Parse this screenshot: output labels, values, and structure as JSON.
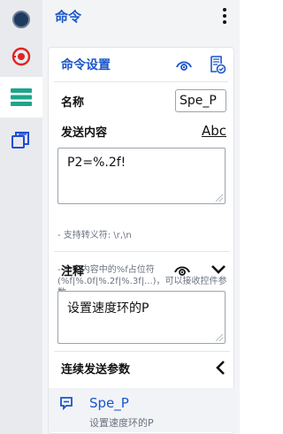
{
  "rail": {
    "items": [
      {
        "icon": "status-dot-icon"
      },
      {
        "icon": "record-target-icon",
        "color": "#e02424"
      },
      {
        "icon": "list-icon",
        "color": "#1fa58b"
      },
      {
        "icon": "copy-windows-icon",
        "color": "#1d4ed8"
      }
    ]
  },
  "panel": {
    "title": "命令"
  },
  "card": {
    "title": "命令设置",
    "name_label": "名称",
    "name_value": "Spe_P",
    "send_label": "发送内容",
    "send_format": "Abc",
    "send_content": "P2=%.2f!",
    "hint_line1": "- 支持转义符: \\r,\\n",
    "hint_line2": "- 命令内容中的%f占位符(%f|%.0f|%.2f|%.3f|...)，可以接收控件参数",
    "comment_label": "注释",
    "comment_value": "设置速度环的P",
    "continuous_label": "连续发送参数",
    "param_name": "Spe_P",
    "param_desc": "设置速度环的P"
  },
  "colors": {
    "accent": "#1a56c9",
    "rail_bg": "#e8eaed",
    "red": "#e02424",
    "teal": "#1fa58b"
  }
}
